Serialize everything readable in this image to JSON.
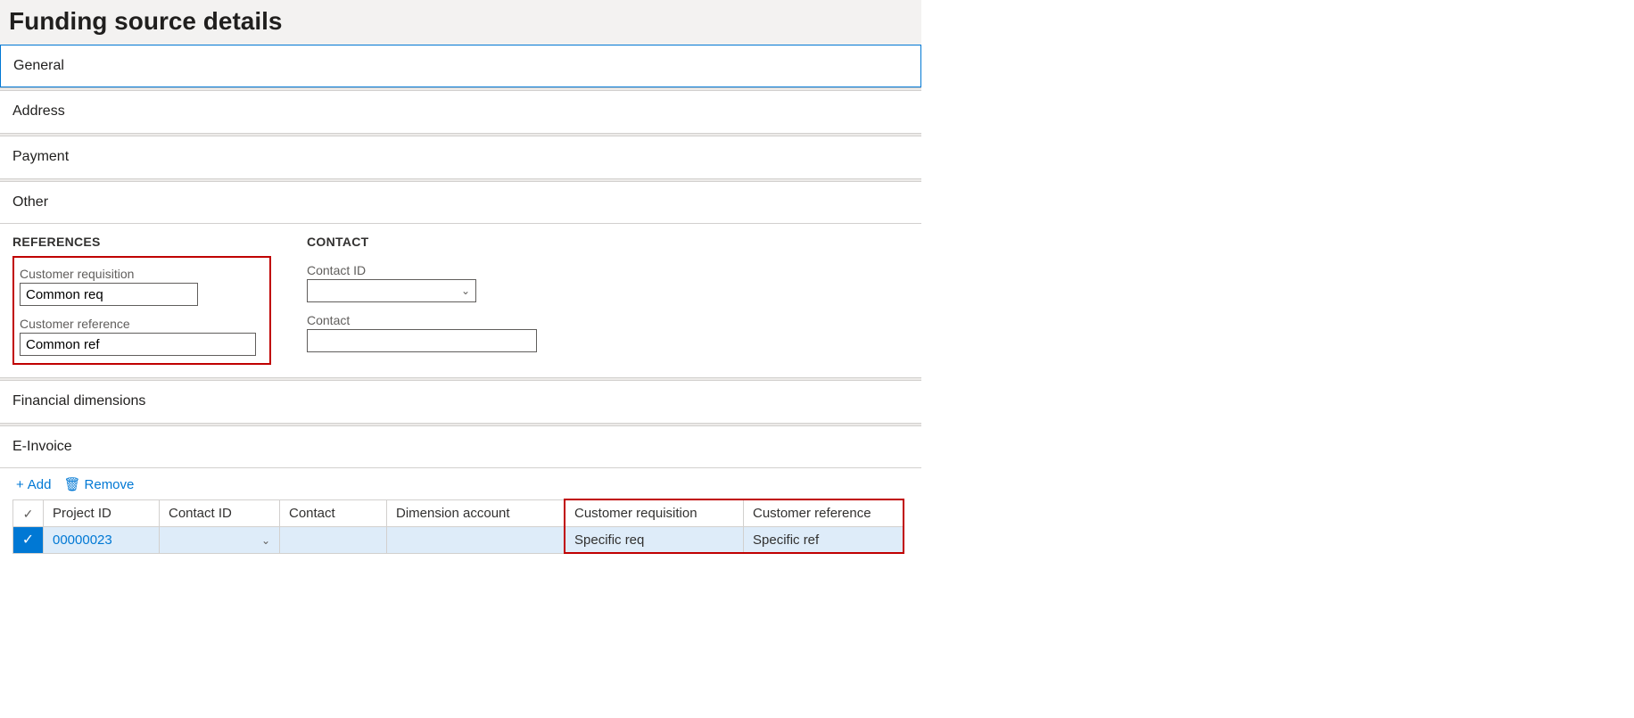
{
  "page": {
    "title": "Funding source details"
  },
  "tabs": {
    "general": "General",
    "address": "Address",
    "payment": "Payment",
    "other": "Other",
    "findim": "Financial dimensions",
    "einvoice": "E-Invoice"
  },
  "other": {
    "references_heading": "REFERENCES",
    "contact_heading": "CONTACT",
    "customer_requisition_label": "Customer requisition",
    "customer_requisition_value": "Common req",
    "customer_reference_label": "Customer reference",
    "customer_reference_value": "Common ref",
    "contact_id_label": "Contact ID",
    "contact_id_value": "",
    "contact_label": "Contact",
    "contact_value": ""
  },
  "einvoice": {
    "toolbar": {
      "add": "Add",
      "remove": "Remove"
    },
    "columns": {
      "project_id": "Project ID",
      "contact_id": "Contact ID",
      "contact": "Contact",
      "dimension_account": "Dimension account",
      "customer_requisition": "Customer requisition",
      "customer_reference": "Customer reference"
    },
    "rows": [
      {
        "project_id": "00000023",
        "contact_id": "",
        "contact": "",
        "dimension_account": "",
        "customer_requisition": "Specific req",
        "customer_reference": "Specific ref"
      }
    ]
  }
}
